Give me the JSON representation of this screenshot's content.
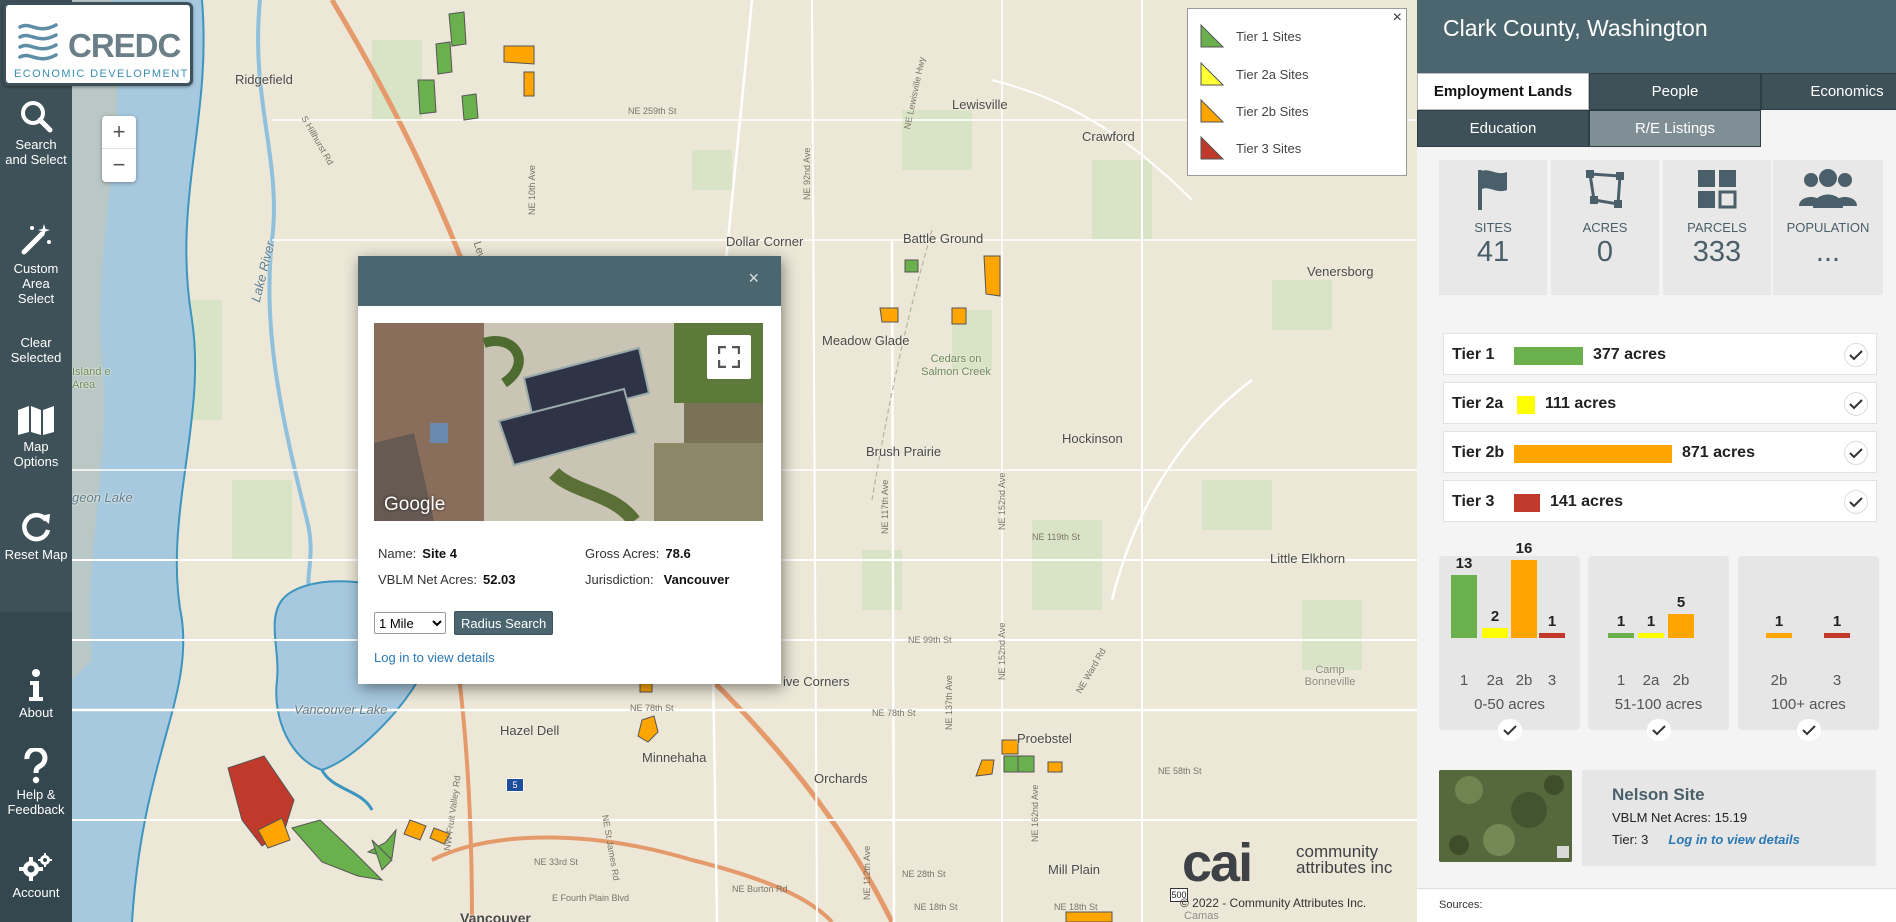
{
  "logo": {
    "word": "CREDC",
    "sub": "ECONOMIC DEVELOPMENT"
  },
  "toolbar": {
    "search": "Search and Select",
    "custom_area": "Custom Area Select",
    "clear": "Clear Selected",
    "map_options": "Map Options",
    "reset": "Reset Map",
    "about": "About",
    "help": "Help & Feedback",
    "account": "Account"
  },
  "map": {
    "zoom_in": "+",
    "zoom_out": "−",
    "places": {
      "ridgefield": "Ridgefield",
      "lewisville": "Lewisville",
      "crawford": "Crawford",
      "dollar_corner": "Dollar Corner",
      "battle_ground": "Battle Ground",
      "venersborg": "Venersborg",
      "meadow_glade": "Meadow Glade",
      "cedars": "Cedars on Salmon Creek",
      "hockinson": "Hockinson",
      "brush_prairie": "Brush Prairie",
      "little_elkhorn": "Little Elkhorn",
      "camp_bonneville": "Camp Bonneville",
      "five_corners": "ive Corners",
      "hazel_dell": "Hazel Dell",
      "minnehaha": "Minnehaha",
      "orchards": "Orchards",
      "proebstel": "Proebstel",
      "mill_plain": "Mill Plain",
      "vancouver": "Vancouver",
      "vancouver_lake": "Vancouver Lake",
      "lake_river": "Lake River",
      "sturgeon_lake": "geon Lake",
      "island_area": "Island e Area",
      "camas": "Camas"
    },
    "roads": {
      "ne259": "NE 259th St",
      "ne119": "NE 119th St",
      "ne99": "NE 99th St",
      "ne78": "NE 78th St",
      "ne78w": "NE 78th St",
      "ne58": "NE 58th St",
      "ne28": "NE 28th St",
      "ne18": "NE 18th St",
      "ne33": "NE 33rd St",
      "burton": "NE Burton Rd",
      "fourth_plain": "E Fourth Plain Blvd",
      "lewis_clark": "Lewis and Clark",
      "ne10": "NE 10th Ave",
      "ne92": "NE 92nd Ave",
      "ne117": "NE 117th Ave",
      "ne152": "NE 152nd Ave",
      "ne137": "NE 137th Ave",
      "ne162": "NE 162nd Ave",
      "ne112": "NE 112th Ave",
      "lewisville_hwy": "NE Lewisville Hwy",
      "hillhurst": "S Hillhurst Rd",
      "fruit_valley": "NW Fruit Valley Rd",
      "st_james": "NE St James Rd",
      "ward": "NE Ward Rd",
      "ne10b": "NE 10th Av",
      "i5": "5",
      "r500": "500"
    }
  },
  "legend": {
    "close": "×",
    "items": [
      {
        "label": "Tier 1 Sites",
        "color": "#6ab04c"
      },
      {
        "label": "Tier 2a Sites",
        "color": "#ffff33"
      },
      {
        "label": "Tier 2b Sites",
        "color": "#ffa500"
      },
      {
        "label": "Tier 3 Sites",
        "color": "#c0392b"
      }
    ]
  },
  "popup": {
    "close": "×",
    "google": "Google",
    "name_label": "Name:",
    "name_value": "Site 4",
    "gross_label": "Gross Acres:",
    "gross_value": "78.6",
    "vblm_label": "VBLM Net Acres:",
    "vblm_value": "52.03",
    "juris_label": "Jurisdiction:",
    "juris_value": "Vancouver",
    "radius_selected": "1 Mile",
    "radius_button": "Radius Search",
    "login_link": "Log in to view details"
  },
  "branding": {
    "cai": "cai",
    "cai_small_1": "community",
    "cai_small_2": "attributes inc",
    "copyright": "© 2022 - Community Attributes Inc."
  },
  "panel": {
    "title": "Clark County, Washington",
    "tabs": [
      "Employment Lands",
      "People",
      "Economics",
      "Education",
      "R/E Listings"
    ],
    "stats": [
      {
        "label": "SITES",
        "value": "41"
      },
      {
        "label": "ACRES",
        "value": "0"
      },
      {
        "label": "PARCELS",
        "value": "333"
      },
      {
        "label": "POPULATION",
        "value": "..."
      }
    ],
    "tiers": [
      {
        "name": "Tier 1",
        "acres": 377,
        "acres_label": "377 acres",
        "color": "#6ab04c"
      },
      {
        "name": "Tier 2a",
        "acres": 111,
        "acres_label": "111 acres",
        "color": "#ffff00"
      },
      {
        "name": "Tier 2b",
        "acres": 871,
        "acres_label": "871 acres",
        "color": "#ffa500"
      },
      {
        "name": "Tier 3",
        "acres": 141,
        "acres_label": "141 acres",
        "color": "#c0392b"
      }
    ],
    "histograms": [
      {
        "caption": "0-50 acres",
        "bars": [
          {
            "x": "1",
            "n": 13,
            "color": "#6ab04c"
          },
          {
            "x": "2a",
            "n": 2,
            "color": "#ffff00"
          },
          {
            "x": "2b",
            "n": 16,
            "color": "#ffa500"
          },
          {
            "x": "3",
            "n": 1,
            "color": "#c0392b"
          }
        ]
      },
      {
        "caption": "51-100 acres",
        "bars": [
          {
            "x": "1",
            "n": 1,
            "color": "#6ab04c"
          },
          {
            "x": "2a",
            "n": 1,
            "color": "#ffff00"
          },
          {
            "x": "2b",
            "n": 5,
            "color": "#ffa500"
          }
        ]
      },
      {
        "caption": "100+ acres",
        "bars": [
          {
            "x": "2b",
            "n": 1,
            "color": "#ffa500"
          },
          {
            "x": "3",
            "n": 1,
            "color": "#c0392b"
          }
        ]
      }
    ],
    "featured": {
      "title": "Nelson Site",
      "vblm_label": "VBLM Net Acres:",
      "vblm_value": "15.19",
      "tier_label": "Tier:",
      "tier_value": "3",
      "login_link": "Log in to view details"
    },
    "sources": "Sources:"
  }
}
